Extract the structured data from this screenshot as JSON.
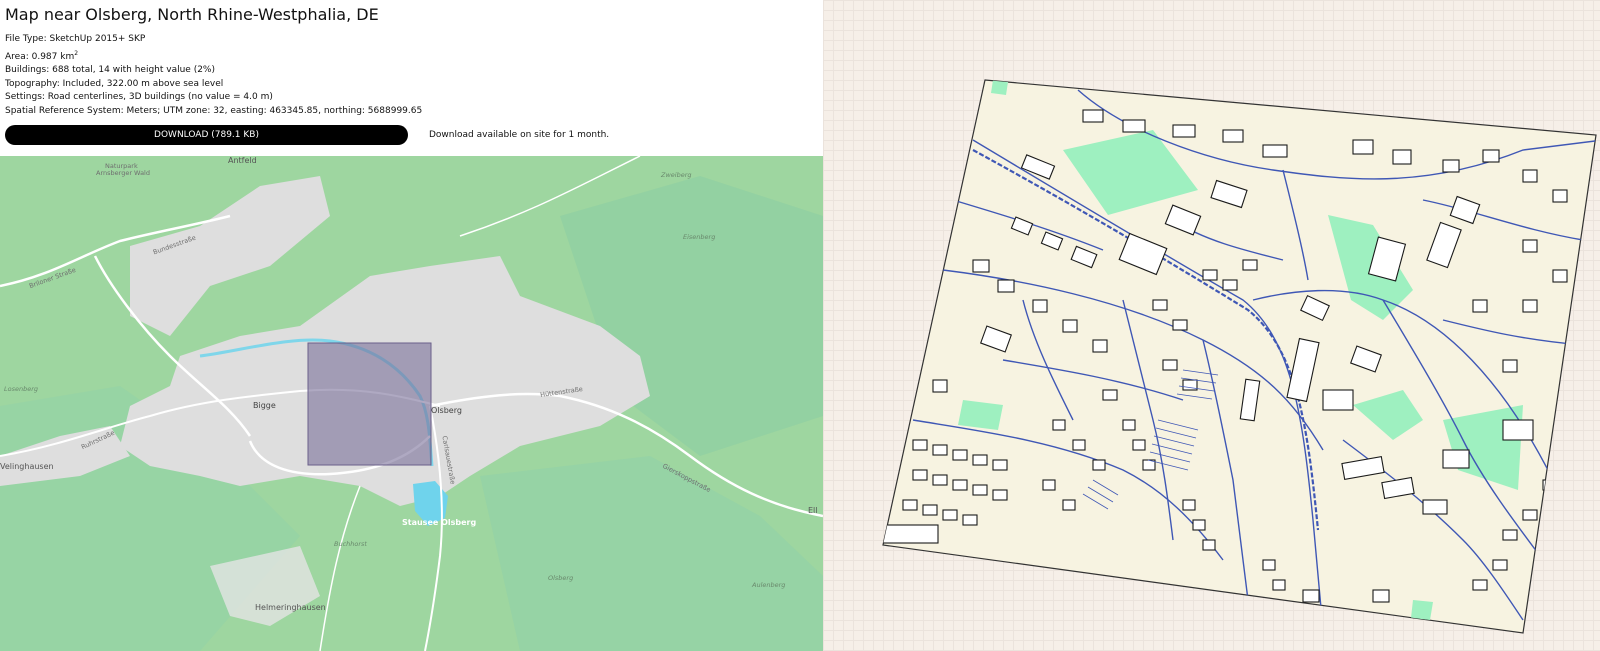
{
  "page": {
    "title": "Map near Olsberg, North Rhine-Westphalia, DE"
  },
  "info": {
    "file_type": "File Type: SketchUp 2015+ SKP",
    "area_prefix": "Area: 0.987 km",
    "area_sup": "2",
    "buildings": "Buildings: 688 total, 14 with height value (2%)",
    "topography": "Topography: Included, 322.00 m above sea level",
    "settings": "Settings: Road centerlines, 3D buildings (no value = 4.0 m)",
    "srs": "Spatial Reference System: Meters; UTM zone: 32, easting: 463345.85, northing: 5688999.65"
  },
  "download": {
    "button_label": "DOWNLOAD (789.1 KB)",
    "note": "Download available on site for 1 month."
  },
  "map": {
    "labels": {
      "naturpark": "Naturpark",
      "arnsberger": "Arnsberger Wald",
      "antfeld": "Antfeld",
      "zweiberg": "Zweiberg",
      "bundesstrasse": "Bundesstraße",
      "briloner": "Briloner Straße",
      "eisenberg": "Eisenberg",
      "losenberg": "Losenberg",
      "bigge": "Bigge",
      "olsberg": "Olsberg",
      "huettenstrasse": "Hüttenstraße",
      "ruhrstrasse": "Ruhrstraße",
      "gierskoppstrasse": "Gierskoppstraße",
      "carlsauestrasse": "Carlsauestraße",
      "velinghausen": "Velinghausen",
      "stausee": "Stausee Olsberg",
      "buchhorst": "Buchhorst",
      "olsberg_hill": "Olsberg",
      "aulenberg": "Aulenberg",
      "helmeringhausen": "Helmeringhausen",
      "ell": "Ell"
    },
    "colors": {
      "forest": "#9ed6a0",
      "urban": "#dedede",
      "selection": "#7a6f9a",
      "water": "#6fd3ec"
    }
  },
  "model": {
    "colors": {
      "ground": "#f7f3e1",
      "roads": "#3f57b5",
      "buildings": "#1a1a1a",
      "green": "#9ef0c0"
    }
  }
}
